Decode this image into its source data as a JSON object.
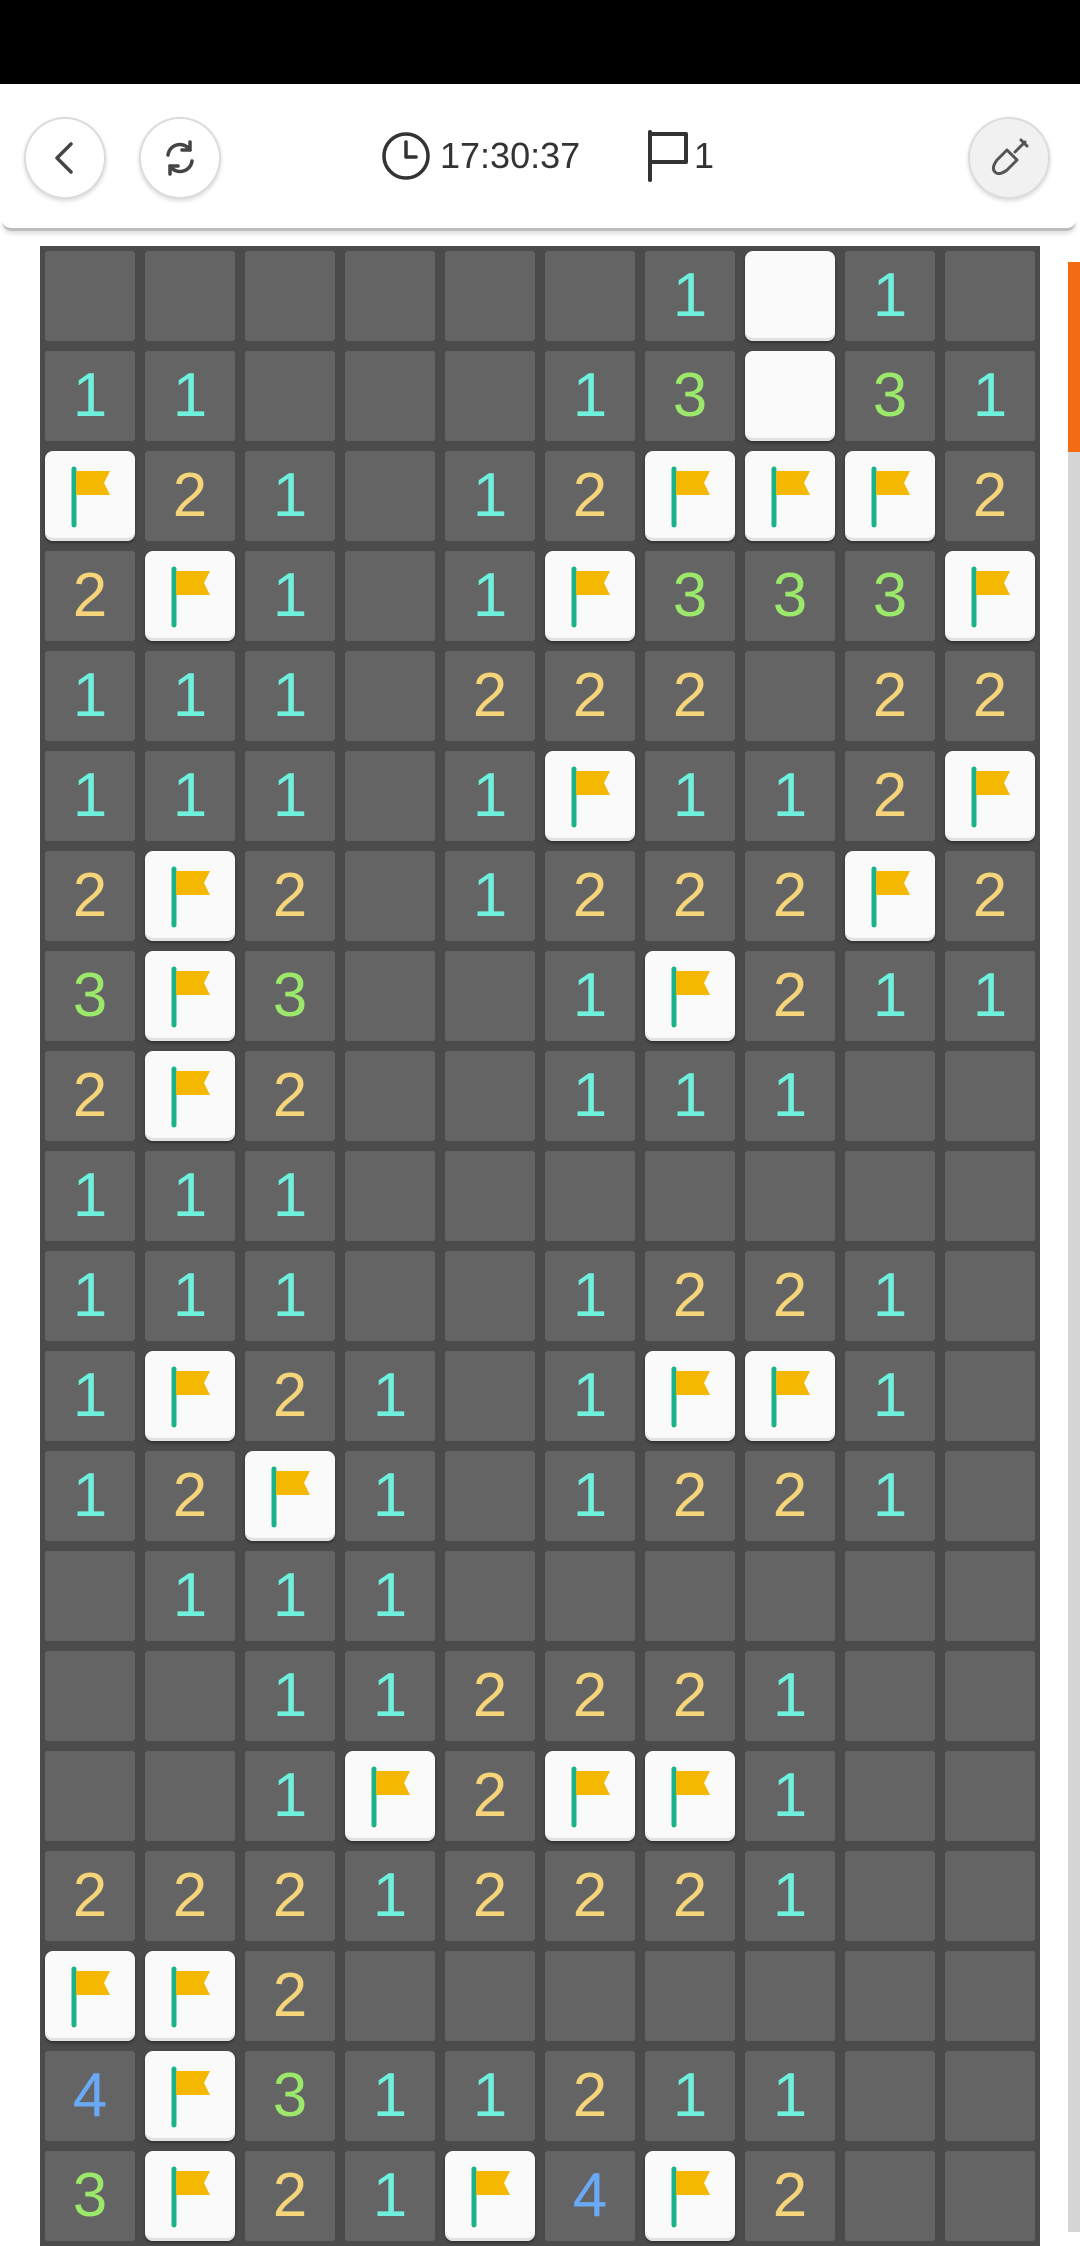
{
  "header": {
    "timer": "17:30:37",
    "flag_count": "1"
  },
  "icons": {
    "back": "chevron-left-icon",
    "restart": "refresh-icon",
    "clock": "clock-icon",
    "flag": "flag-outline-icon",
    "tool": "shovel-icon"
  },
  "colors": {
    "n1": "#6ff0dc",
    "n2": "#f5d47a",
    "n3": "#9be86a",
    "n4": "#6aa9f5",
    "flag": "#f5b800",
    "accent": "#f36b12"
  },
  "board": {
    "rows": [
      [
        ".",
        ".",
        ".",
        ".",
        ".",
        ".",
        "1",
        "W",
        "1",
        "."
      ],
      [
        "1",
        "1",
        ".",
        ".",
        ".",
        "1",
        "3",
        "W",
        "3",
        "1"
      ],
      [
        "F",
        "2",
        "1",
        ".",
        "1",
        "2",
        "F",
        "F",
        "F",
        "2"
      ],
      [
        "2",
        "F",
        "1",
        ".",
        "1",
        "F",
        "3",
        "3",
        "3",
        "F"
      ],
      [
        "1",
        "1",
        "1",
        ".",
        "2",
        "2",
        "2",
        ".",
        "2",
        "2"
      ],
      [
        "1",
        "1",
        "1",
        ".",
        "1",
        "F",
        "1",
        "1",
        "2",
        "F"
      ],
      [
        "2",
        "F",
        "2",
        ".",
        "1",
        "2",
        "2",
        "2",
        "F",
        "2"
      ],
      [
        "3",
        "F",
        "3",
        ".",
        ".",
        "1",
        "F",
        "2",
        "1",
        "1"
      ],
      [
        "2",
        "F",
        "2",
        ".",
        ".",
        "1",
        "1",
        "1",
        ".",
        "."
      ],
      [
        "1",
        "1",
        "1",
        ".",
        ".",
        ".",
        ".",
        ".",
        ".",
        "."
      ],
      [
        "1",
        "1",
        "1",
        ".",
        ".",
        "1",
        "2",
        "2",
        "1",
        "."
      ],
      [
        "1",
        "F",
        "2",
        "1",
        ".",
        "1",
        "F",
        "F",
        "1",
        "."
      ],
      [
        "1",
        "2",
        "F",
        "1",
        ".",
        "1",
        "2",
        "2",
        "1",
        "."
      ],
      [
        ".",
        "1",
        "1",
        "1",
        ".",
        ".",
        ".",
        ".",
        ".",
        "."
      ],
      [
        ".",
        ".",
        "1",
        "1",
        "2",
        "2",
        "2",
        "1",
        ".",
        "."
      ],
      [
        ".",
        ".",
        "1",
        "F",
        "2",
        "F",
        "F",
        "1",
        ".",
        "."
      ],
      [
        "2",
        "2",
        "2",
        "1",
        "2",
        "2",
        "2",
        "1",
        ".",
        "."
      ],
      [
        "F",
        "F",
        "2",
        ".",
        ".",
        ".",
        ".",
        ".",
        ".",
        "."
      ],
      [
        "4",
        "F",
        "3",
        "1",
        "1",
        "2",
        "1",
        "1",
        ".",
        "."
      ],
      [
        "3",
        "F",
        "2",
        "1",
        "F",
        "4",
        "F",
        "2",
        ".",
        "."
      ]
    ]
  }
}
